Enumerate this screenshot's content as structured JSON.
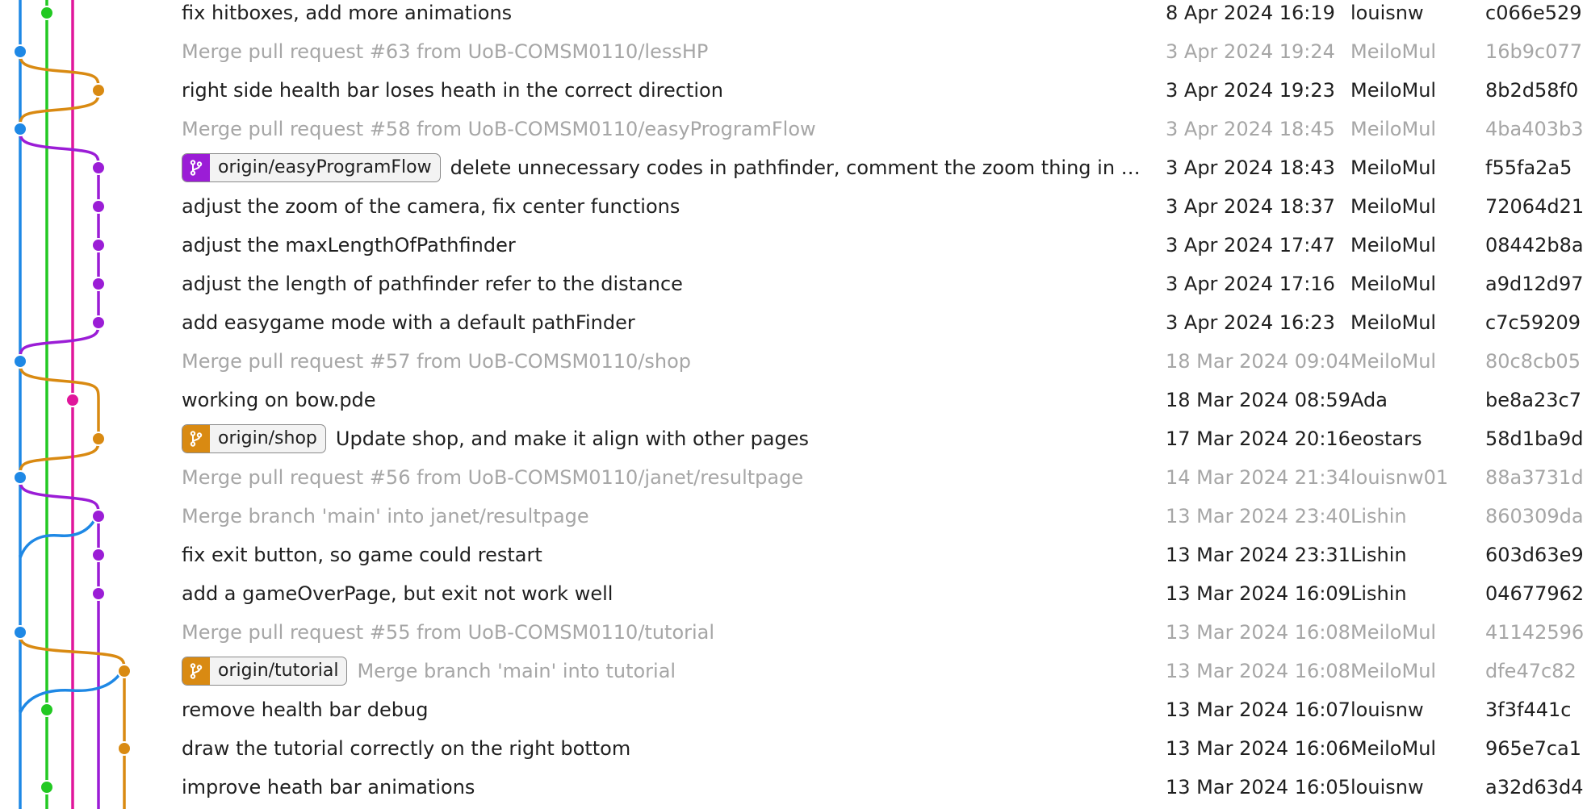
{
  "colors": {
    "blue": "#1e88e5",
    "green": "#22c922",
    "magenta": "#e0169b",
    "purple": "#9b1dd6",
    "orange": "#d98a12",
    "merge_text": "#a6a6a6",
    "text": "#1f1f1f"
  },
  "icons": {
    "branch": "branch-icon"
  },
  "commits": [
    {
      "message": "fix hitboxes, add more animations",
      "date": "8 Apr 2024 16:19",
      "author": "louisnw",
      "hash": "c066e529",
      "merge": false,
      "badge": null
    },
    {
      "message": "Merge pull request #63 from UoB-COMSM0110/lessHP",
      "date": "3 Apr 2024 19:24",
      "author": "MeiloMul",
      "hash": "16b9c077",
      "merge": true,
      "badge": null
    },
    {
      "message": "right side health bar loses heath in the correct direction",
      "date": "3 Apr 2024 19:23",
      "author": "MeiloMul",
      "hash": "8b2d58f0",
      "merge": false,
      "badge": null
    },
    {
      "message": "Merge pull request #58 from UoB-COMSM0110/easyProgramFlow",
      "date": "3 Apr 2024 18:45",
      "author": "MeiloMul",
      "hash": "4ba403b3",
      "merge": true,
      "badge": null
    },
    {
      "message": "delete unnecessary codes in pathfinder, comment the zoom thing in EASY...",
      "date": "3 Apr 2024 18:43",
      "author": "MeiloMul",
      "hash": "f55fa2a5",
      "merge": false,
      "badge": {
        "label": "origin/easyProgramFlow",
        "color": "#9b1dd6"
      }
    },
    {
      "message": "adjust the zoom of the camera, fix center functions",
      "date": "3 Apr 2024 18:37",
      "author": "MeiloMul",
      "hash": "72064d21",
      "merge": false,
      "badge": null
    },
    {
      "message": "adjust the maxLengthOfPathfinder",
      "date": "3 Apr 2024 17:47",
      "author": "MeiloMul",
      "hash": "08442b8a",
      "merge": false,
      "badge": null
    },
    {
      "message": "adjust the length of pathfinder refer to the distance",
      "date": "3 Apr 2024 17:16",
      "author": "MeiloMul",
      "hash": "a9d12d97",
      "merge": false,
      "badge": null
    },
    {
      "message": "add easygame mode with a default pathFinder",
      "date": "3 Apr 2024 16:23",
      "author": "MeiloMul",
      "hash": "c7c59209",
      "merge": false,
      "badge": null
    },
    {
      "message": "Merge pull request #57 from UoB-COMSM0110/shop",
      "date": "18 Mar 2024 09:04",
      "author": "MeiloMul",
      "hash": "80c8cb05",
      "merge": true,
      "badge": null
    },
    {
      "message": "working on bow.pde",
      "date": "18 Mar 2024 08:59",
      "author": "Ada",
      "hash": "be8a23c7",
      "merge": false,
      "badge": null
    },
    {
      "message": "Update shop, and make it align with other pages",
      "date": "17 Mar 2024 20:16",
      "author": "eostars",
      "hash": "58d1ba9d",
      "merge": false,
      "badge": {
        "label": "origin/shop",
        "color": "#d98a12"
      }
    },
    {
      "message": "Merge pull request #56 from UoB-COMSM0110/janet/resultpage",
      "date": "14 Mar 2024 21:34",
      "author": "louisnw01",
      "hash": "88a3731d",
      "merge": true,
      "badge": null
    },
    {
      "message": "Merge branch 'main' into janet/resultpage",
      "date": "13 Mar 2024 23:40",
      "author": "Lishin",
      "hash": "860309da",
      "merge": true,
      "badge": null
    },
    {
      "message": "fix exit button, so game could restart",
      "date": "13 Mar 2024 23:31",
      "author": "Lishin",
      "hash": "603d63e9",
      "merge": false,
      "badge": null
    },
    {
      "message": "add a gameOverPage, but exit not work well",
      "date": "13 Mar 2024 16:09",
      "author": "Lishin",
      "hash": "04677962",
      "merge": false,
      "badge": null
    },
    {
      "message": "Merge pull request #55 from UoB-COMSM0110/tutorial",
      "date": "13 Mar 2024 16:08",
      "author": "MeiloMul",
      "hash": "41142596",
      "merge": true,
      "badge": null
    },
    {
      "message": "Merge branch 'main' into tutorial",
      "date": "13 Mar 2024 16:08",
      "author": "MeiloMul",
      "hash": "dfe47c82",
      "merge": true,
      "badge": {
        "label": "origin/tutorial",
        "color": "#d98a12"
      }
    },
    {
      "message": "remove health bar debug",
      "date": "13 Mar 2024 16:07",
      "author": "louisnw",
      "hash": "3f3f441c",
      "merge": false,
      "badge": null
    },
    {
      "message": "draw the tutorial correctly on the right bottom",
      "date": "13 Mar 2024 16:06",
      "author": "MeiloMul",
      "hash": "965e7ca1",
      "merge": false,
      "badge": null
    },
    {
      "message": "improve heath bar animations",
      "date": "13 Mar 2024 16:05",
      "author": "louisnw",
      "hash": "a32d63d4",
      "merge": false,
      "badge": null
    }
  ]
}
